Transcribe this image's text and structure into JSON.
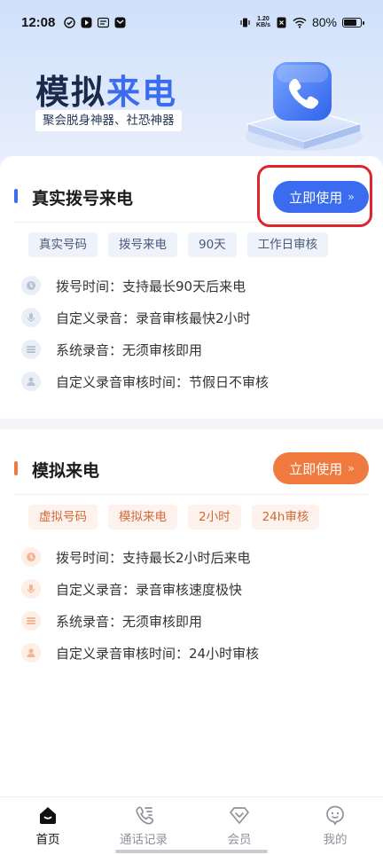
{
  "status_bar": {
    "time": "12:08",
    "net_speed_value": "1.20",
    "net_speed_unit": "KB/s",
    "battery": "80%",
    "battery_level": 0.8
  },
  "header": {
    "title_part1": "模拟",
    "title_part2": "来电",
    "subtitle": "聚会脱身神器、社恐神器"
  },
  "card_real": {
    "title": "真实拨号来电",
    "button_label": "立即使用",
    "accent": "#3b6cf0",
    "tags": [
      "真实号码",
      "拨号来电",
      "90天",
      "工作日审核"
    ],
    "features": [
      "拨号时间：支持最长90天后来电",
      "自定义录音：录音审核最快2小时",
      "系统录音：无须审核即用",
      "自定义录音审核时间：节假日不审核"
    ]
  },
  "card_sim": {
    "title": "模拟来电",
    "button_label": "立即使用",
    "accent": "#f07a3e",
    "tags": [
      "虚拟号码",
      "模拟来电",
      "2小时",
      "24h审核"
    ],
    "features": [
      "拨号时间：支持最长2小时后来电",
      "自定义录音：录音审核速度极快",
      "系统录音：无须审核即用",
      "自定义录音审核时间：24小时审核"
    ]
  },
  "tabbar": {
    "items": [
      {
        "label": "首页",
        "icon": "home-icon",
        "active": true
      },
      {
        "label": "通话记录",
        "icon": "call-log-icon",
        "active": false
      },
      {
        "label": "会员",
        "icon": "diamond-icon",
        "active": false
      },
      {
        "label": "我的",
        "icon": "profile-icon",
        "active": false
      }
    ]
  }
}
